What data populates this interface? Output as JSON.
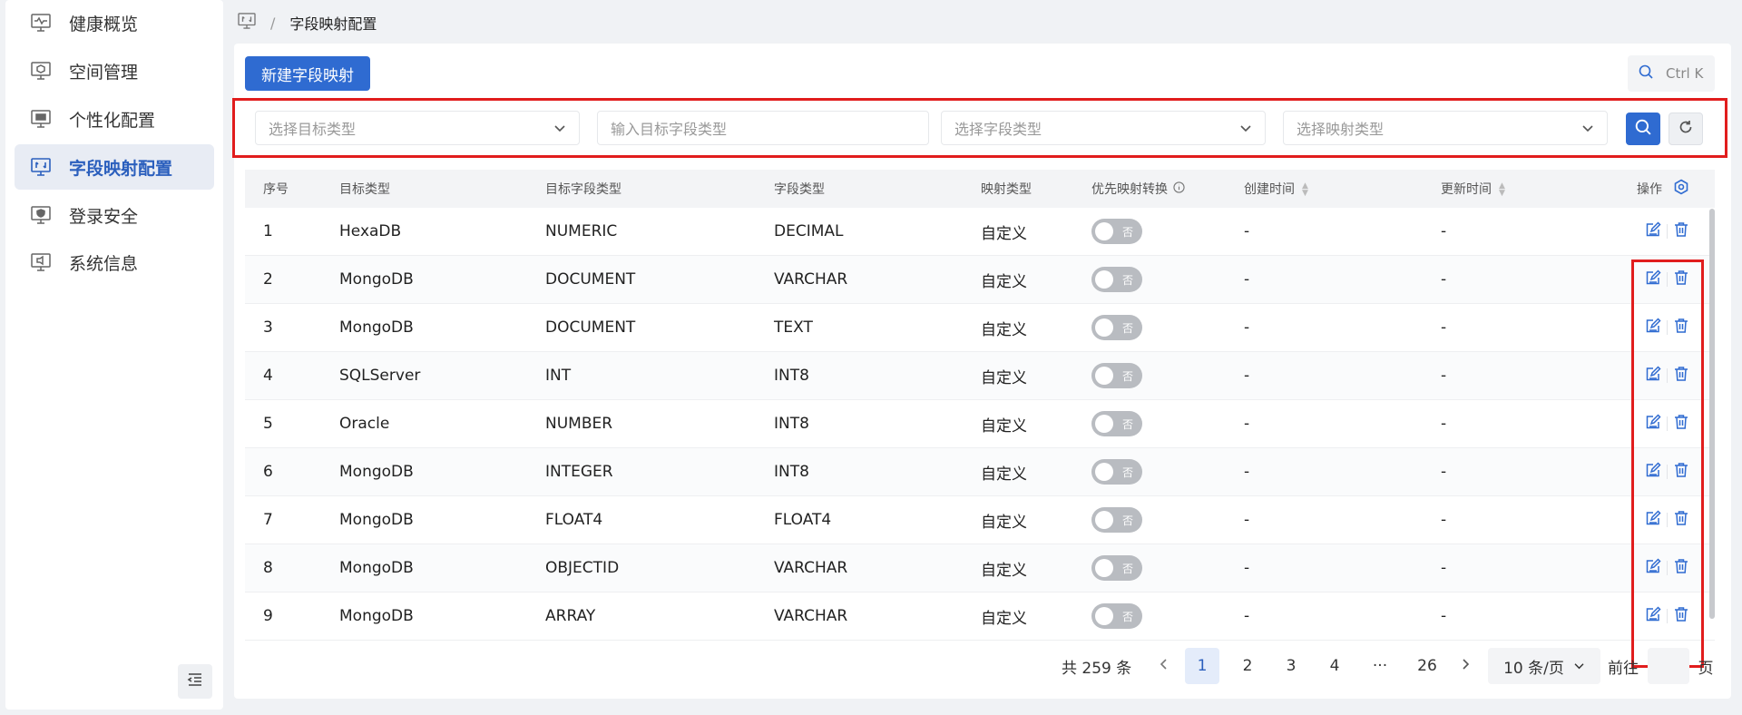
{
  "sidebar": {
    "items": [
      {
        "label": "健康概览",
        "icon": "heartbeat-monitor-icon",
        "active": false
      },
      {
        "label": "空间管理",
        "icon": "space-monitor-icon",
        "active": false
      },
      {
        "label": "个性化配置",
        "icon": "personalize-monitor-icon",
        "active": false
      },
      {
        "label": "字段映射配置",
        "icon": "mapping-monitor-icon",
        "active": true
      },
      {
        "label": "登录安全",
        "icon": "security-monitor-icon",
        "active": false
      },
      {
        "label": "系统信息",
        "icon": "system-info-monitor-icon",
        "active": false
      }
    ]
  },
  "breadcrumb": {
    "separator": "/",
    "current": "字段映射配置"
  },
  "toolbar": {
    "new_button": "新建字段映射",
    "shortcut": "Ctrl K"
  },
  "filters": {
    "target_type_placeholder": "选择目标类型",
    "target_field_type_placeholder": "输入目标字段类型",
    "field_type_placeholder": "选择字段类型",
    "mapping_type_placeholder": "选择映射类型"
  },
  "table": {
    "headers": {
      "index": "序号",
      "target_type": "目标类型",
      "target_field_type": "目标字段类型",
      "field_type": "字段类型",
      "mapping_type": "映射类型",
      "priority": "优先映射转换",
      "created": "创建时间",
      "updated": "更新时间",
      "actions": "操作"
    },
    "toggle_off_label": "否",
    "rows": [
      {
        "index": "1",
        "target_type": "HexaDB",
        "target_field_type": "NUMERIC",
        "field_type": "DECIMAL",
        "mapping_type": "自定义",
        "created": "-",
        "updated": "-"
      },
      {
        "index": "2",
        "target_type": "MongoDB",
        "target_field_type": "DOCUMENT",
        "field_type": "VARCHAR",
        "mapping_type": "自定义",
        "created": "-",
        "updated": "-"
      },
      {
        "index": "3",
        "target_type": "MongoDB",
        "target_field_type": "DOCUMENT",
        "field_type": "TEXT",
        "mapping_type": "自定义",
        "created": "-",
        "updated": "-"
      },
      {
        "index": "4",
        "target_type": "SQLServer",
        "target_field_type": "INT",
        "field_type": "INT8",
        "mapping_type": "自定义",
        "created": "-",
        "updated": "-"
      },
      {
        "index": "5",
        "target_type": "Oracle",
        "target_field_type": "NUMBER",
        "field_type": "INT8",
        "mapping_type": "自定义",
        "created": "-",
        "updated": "-"
      },
      {
        "index": "6",
        "target_type": "MongoDB",
        "target_field_type": "INTEGER",
        "field_type": "INT8",
        "mapping_type": "自定义",
        "created": "-",
        "updated": "-"
      },
      {
        "index": "7",
        "target_type": "MongoDB",
        "target_field_type": "FLOAT4",
        "field_type": "FLOAT4",
        "mapping_type": "自定义",
        "created": "-",
        "updated": "-"
      },
      {
        "index": "8",
        "target_type": "MongoDB",
        "target_field_type": "OBJECTID",
        "field_type": "VARCHAR",
        "mapping_type": "自定义",
        "created": "-",
        "updated": "-"
      },
      {
        "index": "9",
        "target_type": "MongoDB",
        "target_field_type": "ARRAY",
        "field_type": "VARCHAR",
        "mapping_type": "自定义",
        "created": "-",
        "updated": "-"
      }
    ]
  },
  "pagination": {
    "total": "共 259 条",
    "pages": [
      "1",
      "2",
      "3",
      "4",
      "···",
      "26"
    ],
    "current": "1",
    "page_size": "10 条/页",
    "goto_label": "前往",
    "page_suffix": "页"
  },
  "colors": {
    "primary": "#2f6bd1",
    "highlight_box": "#e11d1d",
    "toggle_off": "#b9bcc1"
  }
}
